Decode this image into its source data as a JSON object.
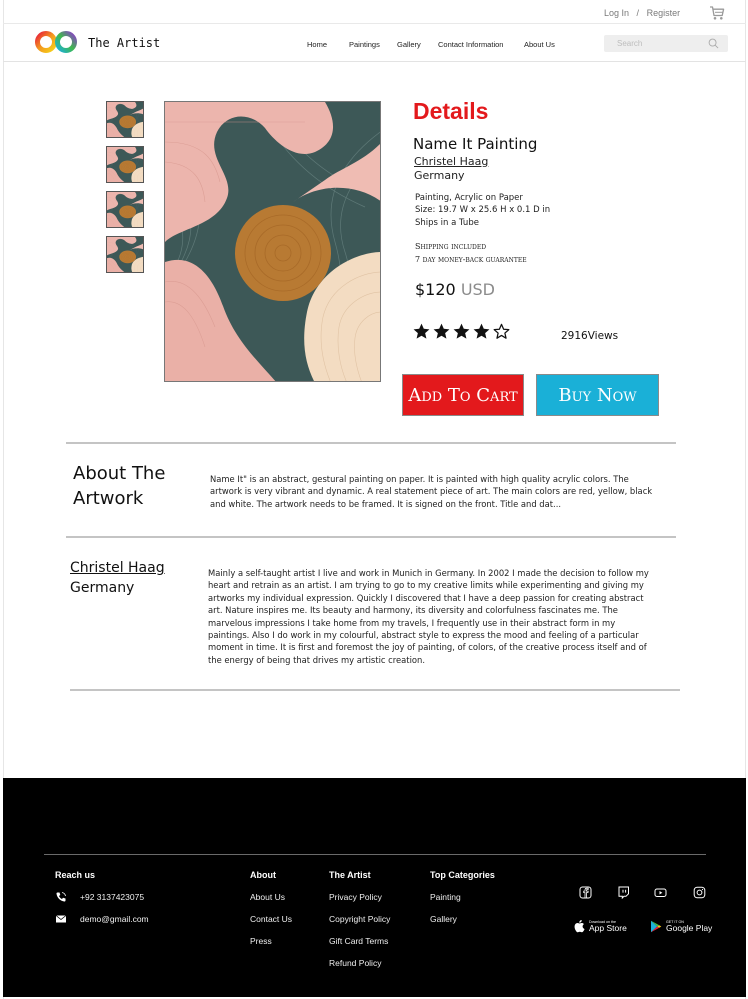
{
  "header": {
    "login_label": "Log In",
    "separator": "/",
    "register_label": "Register",
    "cart_icon": "cart-icon"
  },
  "nav": {
    "brand": "The Artist",
    "logo_icon": "infinity-logo-icon",
    "items": [
      "Home",
      "Paintings",
      "Gallery",
      "Contact Information",
      "About Us"
    ],
    "search_placeholder": "Search",
    "search_icon": "search-icon"
  },
  "product": {
    "section_title": "Details",
    "title": "Name It Painting",
    "artist": "Christel Haag",
    "country": "Germany",
    "medium": "Painting, Acrylic on Paper",
    "size": "Size: 19.7 W x 25.6 H x 0.1 D in",
    "shipping_format": "Ships in a Tube",
    "shipping_note": "Shipping included",
    "guarantee": "7 day money-back guarantee",
    "price": "$120",
    "currency": "USD",
    "rating": 4,
    "rating_max": 5,
    "views": "2916Views",
    "add_to_cart": "Add To Cart",
    "buy_now": "Buy Now",
    "thumbnails_count": 4
  },
  "about_artwork": {
    "heading": "About The Artwork",
    "text": "Name It\" is an abstract, gestural painting on paper. It is painted with high quality acrylic colors. The artwork is very vibrant and dynamic. A real statement piece of art. The main colors are red, yellow, black and white. The artwork needs to be framed. It is signed on the front. Title and dat..."
  },
  "artist_section": {
    "name": "Christel Haag",
    "country": "Germany",
    "bio": "Mainly a self-taught artist I live and work in Munich in Germany. In 2002 I made the decision to follow my heart and retrain as an artist. I am trying to go to my creative limits while experimenting and giving my artworks my individual expression. Quickly I discovered that I have a deep passion for creating abstract art. Nature inspires me. Its beauty and harmony, its diversity and colorfulness fascinates me. The marvelous impressions I take home from my travels, I frequently use in their abstract form in my paintings. Also I do work in my colourful, abstract style to express the mood and feeling of a particular moment in time. It is first and foremost the joy of painting, of colors, of the creative process itself and of the energy of being that drives my artistic creation."
  },
  "footer": {
    "reach_us": {
      "heading": "Reach us",
      "phone": "+92 3137423075",
      "email": "demo@gmail.com"
    },
    "about": {
      "heading": "About",
      "links": [
        "About Us",
        "Contact Us",
        "Press"
      ]
    },
    "the_artist": {
      "heading": "The Artist",
      "links": [
        "Privacy Policy",
        "Copyright Policy",
        "Gift Card Terms",
        "Refund Policy"
      ]
    },
    "top_categories": {
      "heading": "Top Categories",
      "links": [
        "Painting",
        "Gallery"
      ]
    },
    "social_icons": [
      "facebook-icon",
      "twitch-icon",
      "youtube-icon",
      "instagram-icon"
    ],
    "app_store": {
      "small": "Download on the",
      "big": "App Store"
    },
    "google_play": {
      "small": "GET IT ON",
      "big": "Google Play"
    }
  },
  "colors": {
    "accent_red": "#e3191c",
    "accent_blue": "#1ab0d7",
    "footer_bg": "#000000"
  }
}
